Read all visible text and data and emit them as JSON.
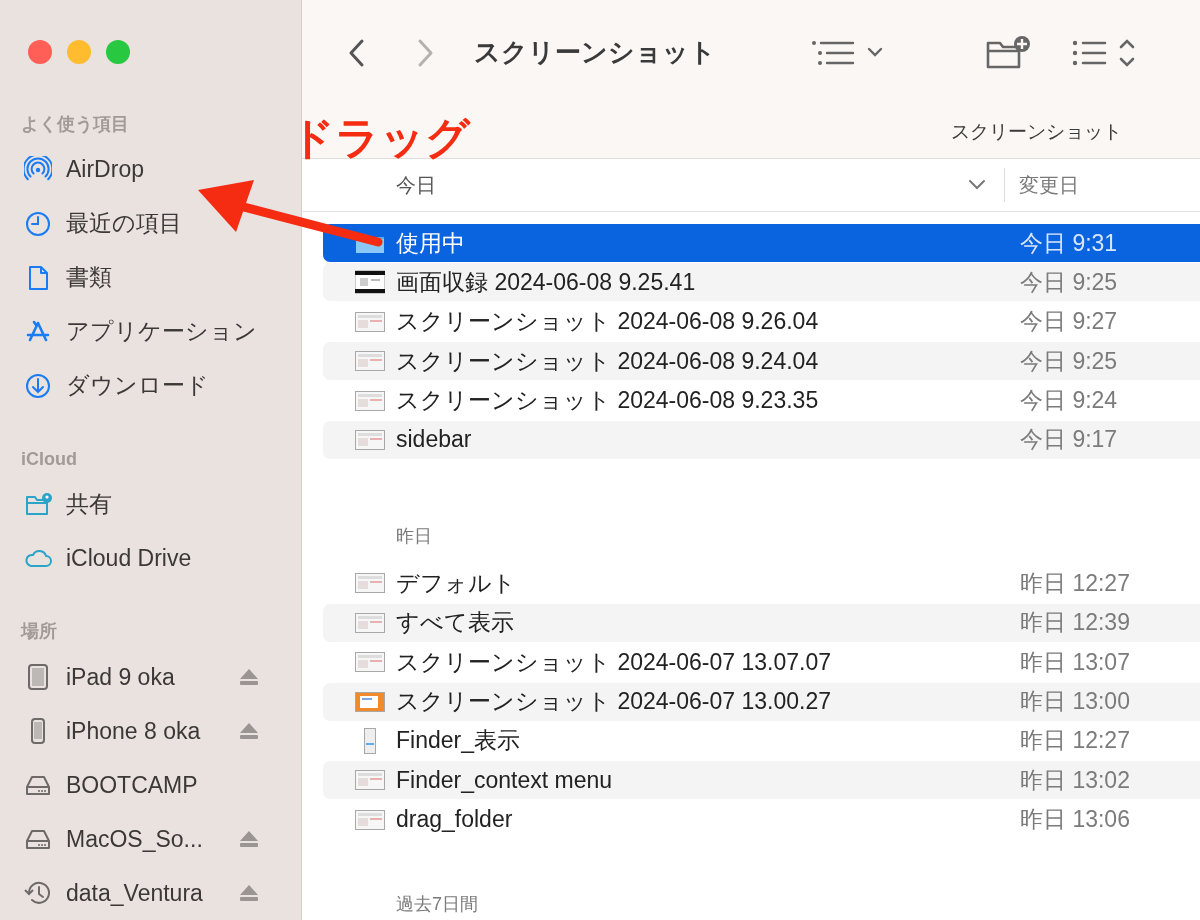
{
  "window": {
    "controls": [
      {
        "color": "#ff5f57"
      },
      {
        "color": "#febc2e"
      },
      {
        "color": "#28c840"
      }
    ]
  },
  "toolbar": {
    "back": {
      "disabled": false
    },
    "forward": {
      "disabled": true
    },
    "title": "スクリーンショット",
    "path_label": "スクリーンショット"
  },
  "sidebar": {
    "sections": [
      {
        "heading": "よく使う項目",
        "items": [
          {
            "label": "AirDrop",
            "kind": "airdrop",
            "eject": false
          },
          {
            "label": "最近の項目",
            "kind": "clock",
            "eject": false
          },
          {
            "label": "書類",
            "kind": "document",
            "eject": false
          },
          {
            "label": "アプリケーション",
            "kind": "apps",
            "eject": false
          },
          {
            "label": "ダウンロード",
            "kind": "download",
            "eject": false
          }
        ]
      },
      {
        "heading": "iCloud",
        "items": [
          {
            "label": "共有",
            "kind": "shared",
            "eject": false
          },
          {
            "label": "iCloud Drive",
            "kind": "cloud",
            "eject": false
          }
        ]
      },
      {
        "heading": "場所",
        "items": [
          {
            "label": "iPad 9 oka",
            "kind": "tablet",
            "eject": true
          },
          {
            "label": "iPhone 8 oka",
            "kind": "phone",
            "eject": true
          },
          {
            "label": "BOOTCAMP",
            "kind": "drive",
            "eject": false
          },
          {
            "label": "MacOS_So...",
            "kind": "drive",
            "eject": true
          },
          {
            "label": "data_Ventura",
            "kind": "history",
            "eject": true
          }
        ]
      }
    ]
  },
  "file_list": {
    "header": {
      "group_label": "今日",
      "column_2": "変更日"
    },
    "sections": [
      {
        "rows": [
          {
            "name": "使用中",
            "modified": "今日 9:31",
            "kind": "folder",
            "selected": true
          },
          {
            "name": "画面収録 2024-06-08 9.25.41",
            "modified": "今日 9:25",
            "kind": "movie",
            "selected": false
          },
          {
            "name": "スクリーンショット 2024-06-08 9.26.04",
            "modified": "今日 9:27",
            "kind": "screenshot",
            "selected": false
          },
          {
            "name": "スクリーンショット 2024-06-08 9.24.04",
            "modified": "今日 9:25",
            "kind": "screenshot",
            "selected": false
          },
          {
            "name": "スクリーンショット 2024-06-08 9.23.35",
            "modified": "今日 9:24",
            "kind": "screenshot",
            "selected": false
          },
          {
            "name": "sidebar",
            "modified": "今日 9:17",
            "kind": "screenshot",
            "selected": false
          }
        ]
      },
      {
        "heading": "昨日",
        "rows": [
          {
            "name": "デフォルト",
            "modified": "昨日 12:27",
            "kind": "screenshot",
            "selected": false
          },
          {
            "name": "すべて表示",
            "modified": "昨日 12:39",
            "kind": "screenshot",
            "selected": false
          },
          {
            "name": "スクリーンショット 2024-06-07 13.07.07",
            "modified": "昨日 13:07",
            "kind": "screenshot",
            "selected": false
          },
          {
            "name": "スクリーンショット 2024-06-07 13.00.27",
            "modified": "昨日 13:00",
            "kind": "colorful",
            "selected": false
          },
          {
            "name": "Finder_表示",
            "modified": "昨日 12:27",
            "kind": "portrait",
            "selected": false
          },
          {
            "name": "Finder_context menu",
            "modified": "昨日 13:02",
            "kind": "screenshot",
            "selected": false
          },
          {
            "name": "drag_folder",
            "modified": "昨日 13:06",
            "kind": "screenshot",
            "selected": false
          }
        ]
      },
      {
        "heading": "過去7日間"
      }
    ]
  },
  "annotation": {
    "label": "ドラッグ"
  }
}
